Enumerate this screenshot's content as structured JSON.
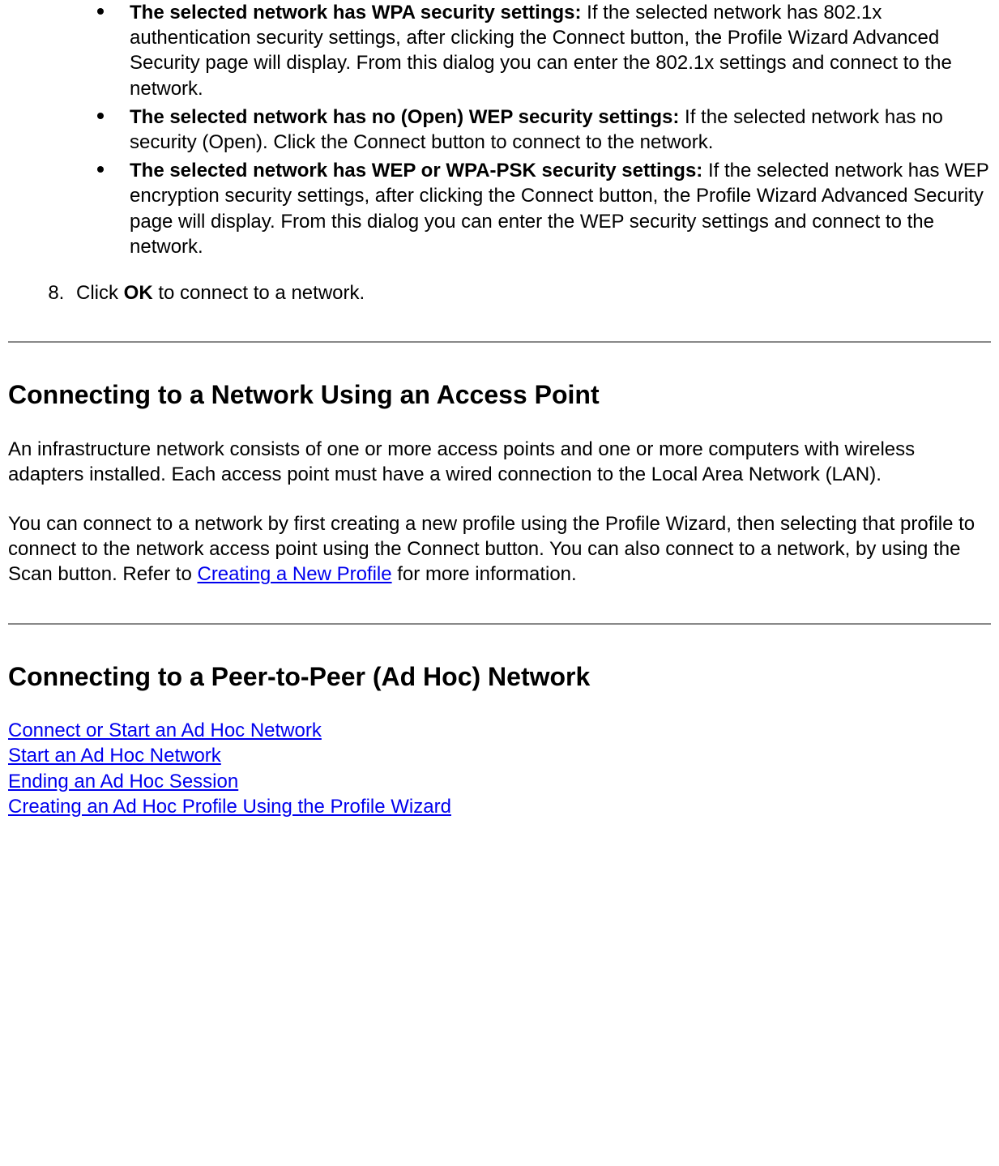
{
  "bullets": [
    {
      "title": "The selected network has WPA security settings:",
      "body": " If the selected network has 802.1x authentication security settings, after clicking the Connect button, the Profile Wizard Advanced Security page will display. From this dialog you can enter the 802.1x settings and connect to the network."
    },
    {
      "title": "The selected network has no (Open) WEP security settings: ",
      "body": " If the selected network has no security (Open). Click the Connect button to connect to the network."
    },
    {
      "title": "The selected network has WEP or WPA-PSK security settings:",
      "body": " If the selected network has WEP encryption security settings, after clicking the Connect button, the Profile Wizard Advanced Security page will display. From this dialog you can enter the WEP security settings and connect to the network."
    }
  ],
  "step8": {
    "pre": "Click ",
    "bold": "OK",
    "post": " to connect to a network."
  },
  "section_ap": {
    "heading": "Connecting to a Network Using an Access Point",
    "para1": "An infrastructure network consists of one or more access points and one or more computers with wireless adapters installed. Each access point must have a wired connection to the Local Area Network (LAN).",
    "para2_pre": "You can connect to a network by first creating a new profile using the Profile Wizard, then selecting that profile to connect to the network access point using the Connect button. You can also connect to a network, by using the Scan button. Refer to ",
    "para2_link": "Creating a New Profile",
    "para2_post": " for more information."
  },
  "section_adhoc": {
    "heading": "Connecting to a Peer-to-Peer (Ad Hoc) Network",
    "links": [
      "Connect or Start an Ad Hoc Network",
      "Start an Ad Hoc Network",
      "Ending an Ad Hoc Session",
      "Creating an Ad Hoc Profile Using the Profile Wizard"
    ]
  }
}
